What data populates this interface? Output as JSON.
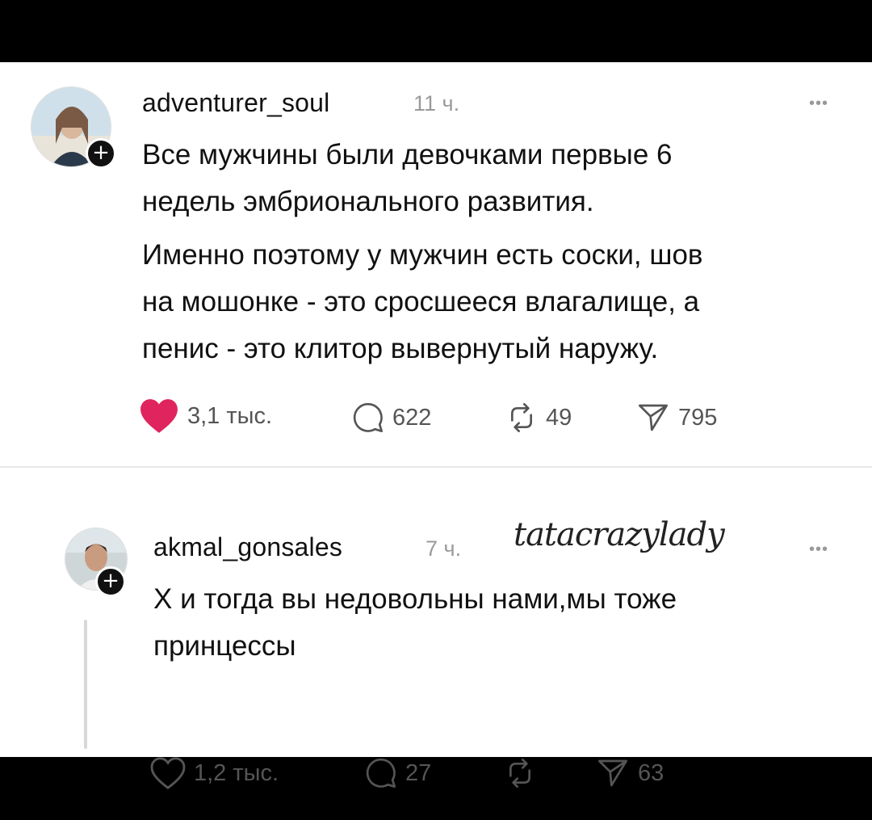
{
  "posts": [
    {
      "username": "adventurer_soul",
      "time": "11 ч.",
      "text_lines": [
        "Все мужчины были девочками первые 6",
        "недель эмбрионального развития."
      ],
      "text_lines_2": [
        "Именно поэтому у мужчин есть соски, шов",
        "на мошонке - это сросшееся влагалище, а",
        "пенис - это клитор вывернутый наружу."
      ],
      "likes": "3,1 тыс.",
      "liked": true,
      "comments": "622",
      "reposts": "49",
      "shares": "795"
    },
    {
      "username": "akmal_gonsales",
      "time": "7 ч.",
      "text_lines": [
        "Х  и тогда вы недовольны нами,мы тоже",
        "принцессы"
      ],
      "likes": "1,2 тыс.",
      "liked": false,
      "comments": "27",
      "reposts": "",
      "shares": "63"
    }
  ],
  "watermark": "tatacrazylady",
  "colors": {
    "like_active": "#e0245e",
    "icon": "#555555",
    "muted": "#9a9a9a"
  },
  "icons": [
    "plus-icon",
    "more-icon",
    "heart-icon",
    "comment-icon",
    "repost-icon",
    "share-icon"
  ]
}
